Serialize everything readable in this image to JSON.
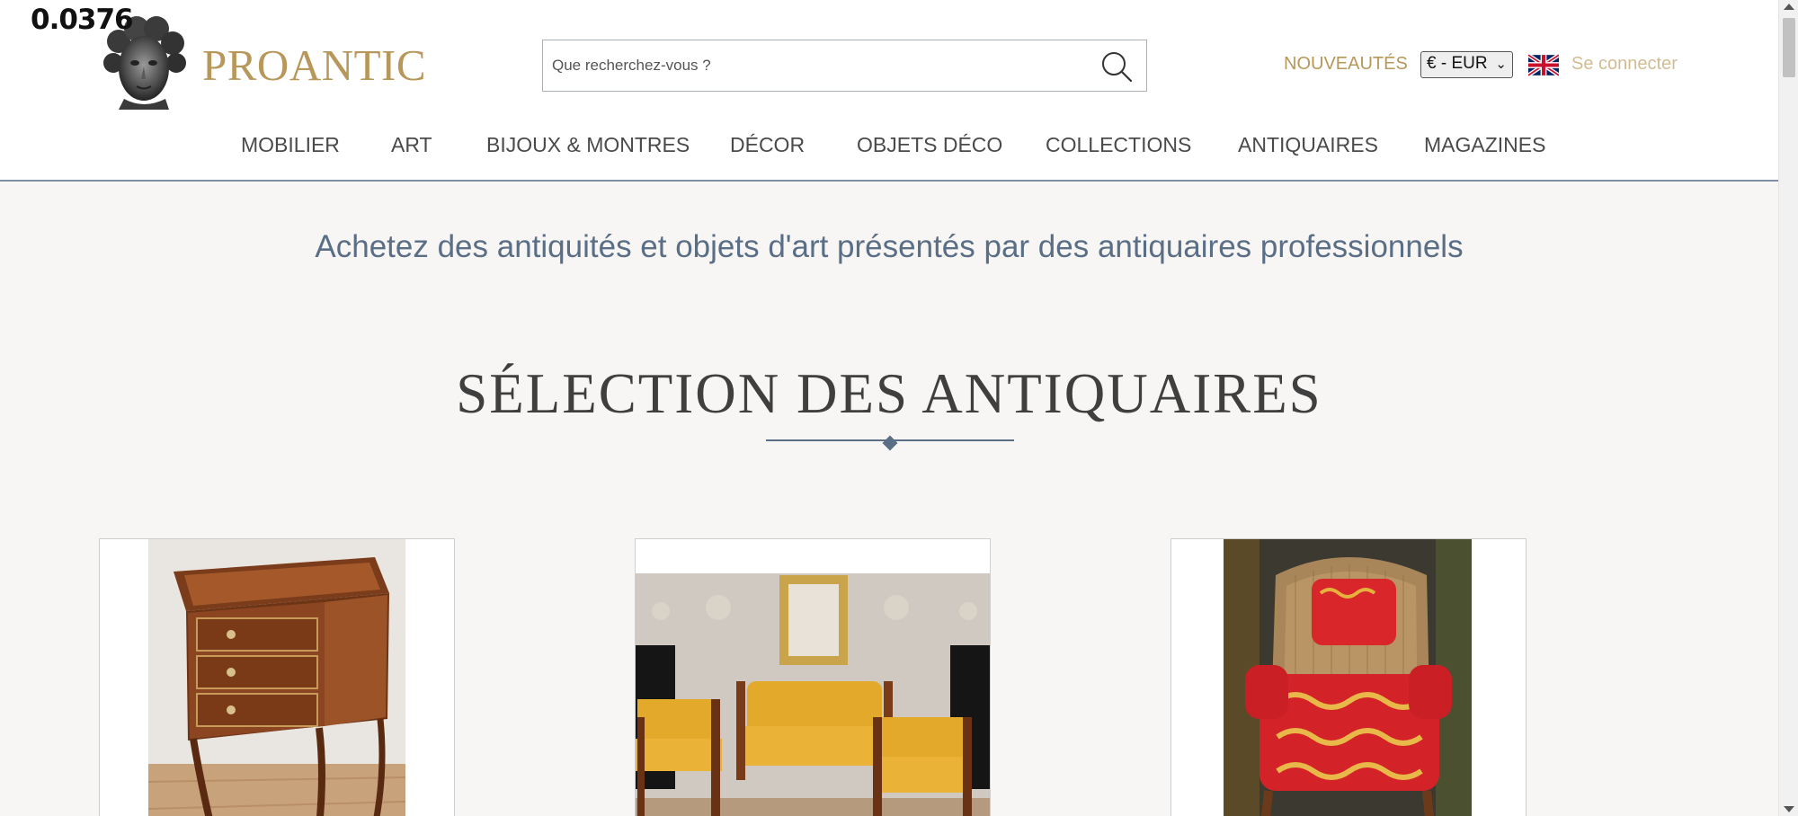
{
  "overlay": {
    "value": "0.0376"
  },
  "header": {
    "logo_text": "PROANTIC",
    "search": {
      "placeholder": "Que recherchez-vous ?",
      "value": ""
    },
    "nouveautes": "NOUVEAUTÉS",
    "currency": "€ - EUR",
    "language_icon": "uk-flag-icon",
    "login": "Se connecter"
  },
  "nav": {
    "items": [
      {
        "label": "MOBILIER"
      },
      {
        "label": "ART"
      },
      {
        "label": "BIJOUX & MONTRES"
      },
      {
        "label": "DÉCOR"
      },
      {
        "label": "OBJETS DÉCO"
      },
      {
        "label": "COLLECTIONS"
      },
      {
        "label": "ANTIQUAIRES"
      },
      {
        "label": "MAGAZINES"
      }
    ]
  },
  "main": {
    "tagline": "Achetez des antiquités et objets d'art présentés par des antiquaires professionnels",
    "section_title": "SÉLECTION DES ANTIQUAIRES",
    "cards": [
      {
        "image": "marquetry-side-table-image"
      },
      {
        "image": "yellow-salon-furniture-image"
      },
      {
        "image": "red-damask-bergere-armchair-image"
      }
    ]
  },
  "colors": {
    "brand_gold": "#b8975a",
    "accent_blue": "#5a6e86",
    "background": "#f7f6f4"
  }
}
